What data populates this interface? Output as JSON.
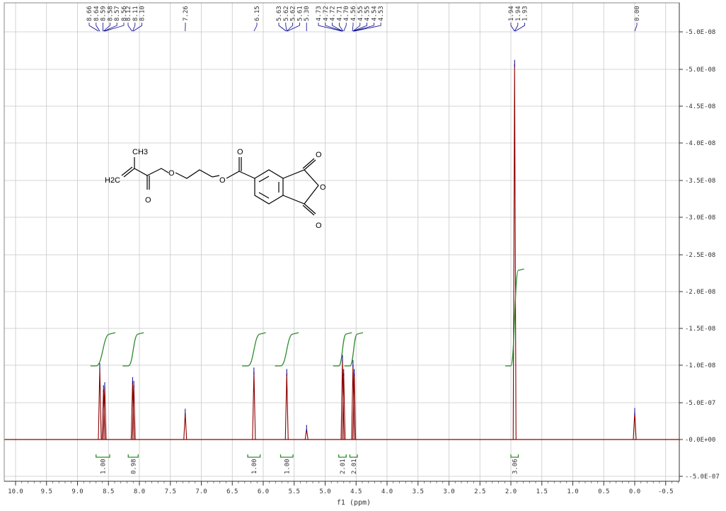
{
  "chart_data": {
    "type": "line",
    "xlabel": "f1 (ppm)",
    "xlim": [
      10.3,
      -0.55
    ],
    "ylim": [
      -5e-07,
      5.5e-08
    ],
    "grid": true,
    "x_ticks": [
      "10.0",
      "9.5",
      "9.0",
      "8.5",
      "8.0",
      "7.5",
      "7.0",
      "6.5",
      "6.0",
      "5.5",
      "5.0",
      "4.5",
      "4.0",
      "3.5",
      "3.0",
      "2.5",
      "2.0",
      "1.5",
      "1.0",
      "0.5",
      "0.0",
      "-0.5"
    ],
    "y_ticks": [
      "5.0E-08",
      "5.0E-08",
      "4.5E-08",
      "4.0E-08",
      "3.5E-08",
      "3.0E-08",
      "2.5E-08",
      "2.0E-08",
      "1.5E-08",
      "1.0E-08",
      "5.0E-07",
      "0.0E+00",
      "-5.0E-07"
    ],
    "peaks": [
      {
        "ppm": 8.64,
        "height": 0.98
      },
      {
        "ppm": 8.58,
        "height": 0.68
      },
      {
        "ppm": 8.56,
        "height": 0.72
      },
      {
        "ppm": 8.11,
        "height": 0.79
      },
      {
        "ppm": 8.09,
        "height": 0.74
      },
      {
        "ppm": 7.26,
        "height": 0.36
      },
      {
        "ppm": 6.15,
        "height": 0.92
      },
      {
        "ppm": 5.62,
        "height": 0.9
      },
      {
        "ppm": 5.3,
        "height": 0.14
      },
      {
        "ppm": 4.72,
        "height": 1.09
      },
      {
        "ppm": 4.7,
        "height": 0.9
      },
      {
        "ppm": 4.55,
        "height": 1.02
      },
      {
        "ppm": 4.53,
        "height": 0.9
      },
      {
        "ppm": 1.94,
        "height": 5.1
      },
      {
        "ppm": 0.0,
        "height": 0.37
      }
    ],
    "integrals": [
      {
        "from": 8.7,
        "to": 8.48,
        "value": "1.00"
      },
      {
        "from": 8.18,
        "to": 8.02,
        "value": "0.98"
      },
      {
        "from": 6.25,
        "to": 6.05,
        "value": "1.00"
      },
      {
        "from": 5.72,
        "to": 5.52,
        "value": "1.00"
      },
      {
        "from": 4.78,
        "to": 4.66,
        "value": "2.01"
      },
      {
        "from": 4.6,
        "to": 4.48,
        "value": "2.01"
      },
      {
        "from": 2.0,
        "to": 1.88,
        "value": "3.06"
      }
    ],
    "peak_labels": [
      {
        "ppm": 8.66,
        "text": "8.66"
      },
      {
        "ppm": 8.64,
        "text": "8.64"
      },
      {
        "ppm": 8.59,
        "text": "8.59"
      },
      {
        "ppm": 8.58,
        "text": "8.58"
      },
      {
        "ppm": 8.57,
        "text": "8.57"
      },
      {
        "ppm": 8.56,
        "text": "8.56"
      },
      {
        "ppm": 8.12,
        "text": "8.12"
      },
      {
        "ppm": 8.11,
        "text": "8.11"
      },
      {
        "ppm": 8.1,
        "text": "8.10"
      },
      {
        "ppm": 7.26,
        "text": "7.26"
      },
      {
        "ppm": 6.15,
        "text": "6.15"
      },
      {
        "ppm": 5.63,
        "text": "5.63"
      },
      {
        "ppm": 5.62,
        "text": "5.62"
      },
      {
        "ppm": 5.62,
        "text": "5.62"
      },
      {
        "ppm": 5.61,
        "text": "5.61"
      },
      {
        "ppm": 5.3,
        "text": "5.30"
      },
      {
        "ppm": 4.73,
        "text": "4.73"
      },
      {
        "ppm": 4.72,
        "text": "4.72"
      },
      {
        "ppm": 4.72,
        "text": "4.72"
      },
      {
        "ppm": 4.71,
        "text": "4.71"
      },
      {
        "ppm": 4.7,
        "text": "4.70"
      },
      {
        "ppm": 4.56,
        "text": "4.56"
      },
      {
        "ppm": 4.55,
        "text": "4.55"
      },
      {
        "ppm": 4.55,
        "text": "4.55"
      },
      {
        "ppm": 4.54,
        "text": "4.54"
      },
      {
        "ppm": 4.53,
        "text": "4.53"
      },
      {
        "ppm": 1.94,
        "text": "1.94"
      },
      {
        "ppm": 1.94,
        "text": "1.94"
      },
      {
        "ppm": 1.93,
        "text": "1.93"
      },
      {
        "ppm": 0.0,
        "text": "0.00"
      }
    ],
    "colors": {
      "spectrum": "#8b0000",
      "integral": "#2e8b2e",
      "peak_marker": "#00008b",
      "grid": "#c8c8c8"
    }
  },
  "structure": {
    "atoms": [
      "CH3",
      "H2C",
      "O",
      "O",
      "O",
      "O",
      "O",
      "O",
      "O"
    ]
  }
}
